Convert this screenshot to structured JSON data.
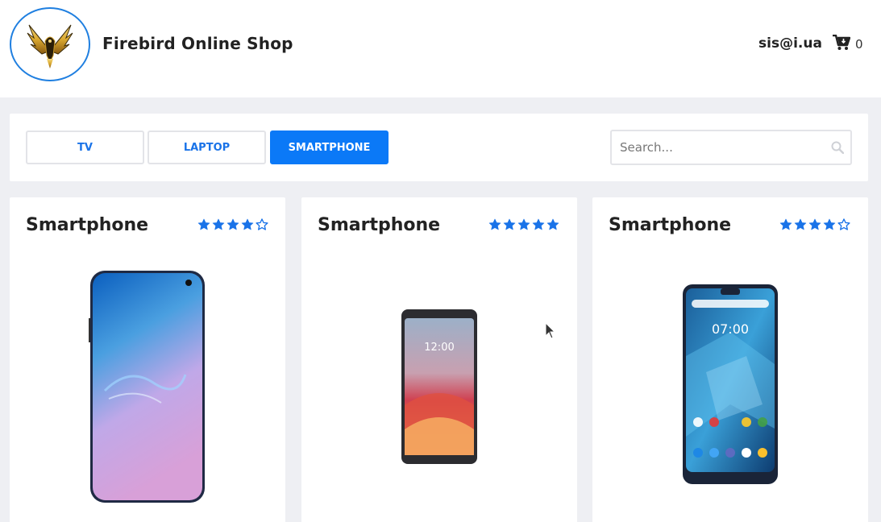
{
  "header": {
    "title": "Firebird Online Shop",
    "user_email": "sis@i.ua",
    "cart_count": "0",
    "logo_icon": "firebird-logo-icon",
    "cart_icon": "cart-icon"
  },
  "categories": [
    {
      "label": "TV",
      "active": false
    },
    {
      "label": "LAPTOP",
      "active": false
    },
    {
      "label": "SMARTPHONE",
      "active": true
    }
  ],
  "search": {
    "placeholder": "Search...",
    "value": "",
    "icon": "search-icon"
  },
  "products": [
    {
      "title": "Smartphone",
      "rating": 4,
      "max_rating": 5,
      "screen_text": ""
    },
    {
      "title": "Smartphone",
      "rating": 5,
      "max_rating": 5,
      "screen_text": "12:00"
    },
    {
      "title": "Smartphone",
      "rating": 4,
      "max_rating": 5,
      "screen_text": "07:00"
    }
  ],
  "colors": {
    "accent": "#0b79f7",
    "star": "#1a73e8",
    "logo_border": "#1f7fe0",
    "background": "#eeeff3"
  }
}
